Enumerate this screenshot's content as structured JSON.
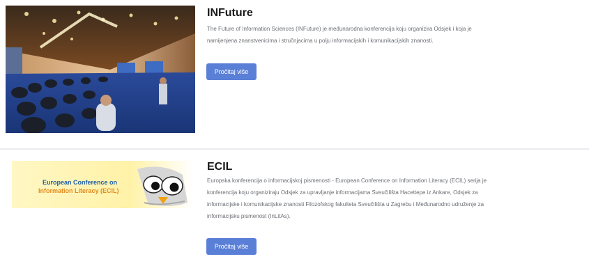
{
  "entries": [
    {
      "title": "INFuture",
      "description": "The Future of Information Sciences (INFuture) je međunarodna konferencija koju organizira Odsjek i koja je namijenjena znanstvenicima i stručnjacima u polju informacijskih i komunikacijskih znanosti.",
      "button_label": "Pročitaj više"
    },
    {
      "title": "ECIL",
      "description": "Europska konferencija o informacijskoj pismenosti - European Conference on Information Literacy (ECIL) serija je konferencija koju organiziraju Odsjek za upravljanje informacijama Sveučilišta Hacettepe iz Ankare, Odsjek za informacijske i komunikacijske znanosti Filozofskog fakulteta Sveučilišta u Zagrebu i Međunarodno udruženje za informacijsku pismenost (InLitAs).",
      "button_label": "Pročitaj više",
      "logo_line1": "European Conference on",
      "logo_line2": "Information Literacy (ECIL)"
    }
  ],
  "colors": {
    "button": "#5a7fd6",
    "logo_blue": "#1f5fa8",
    "logo_orange": "#e08a1e"
  }
}
